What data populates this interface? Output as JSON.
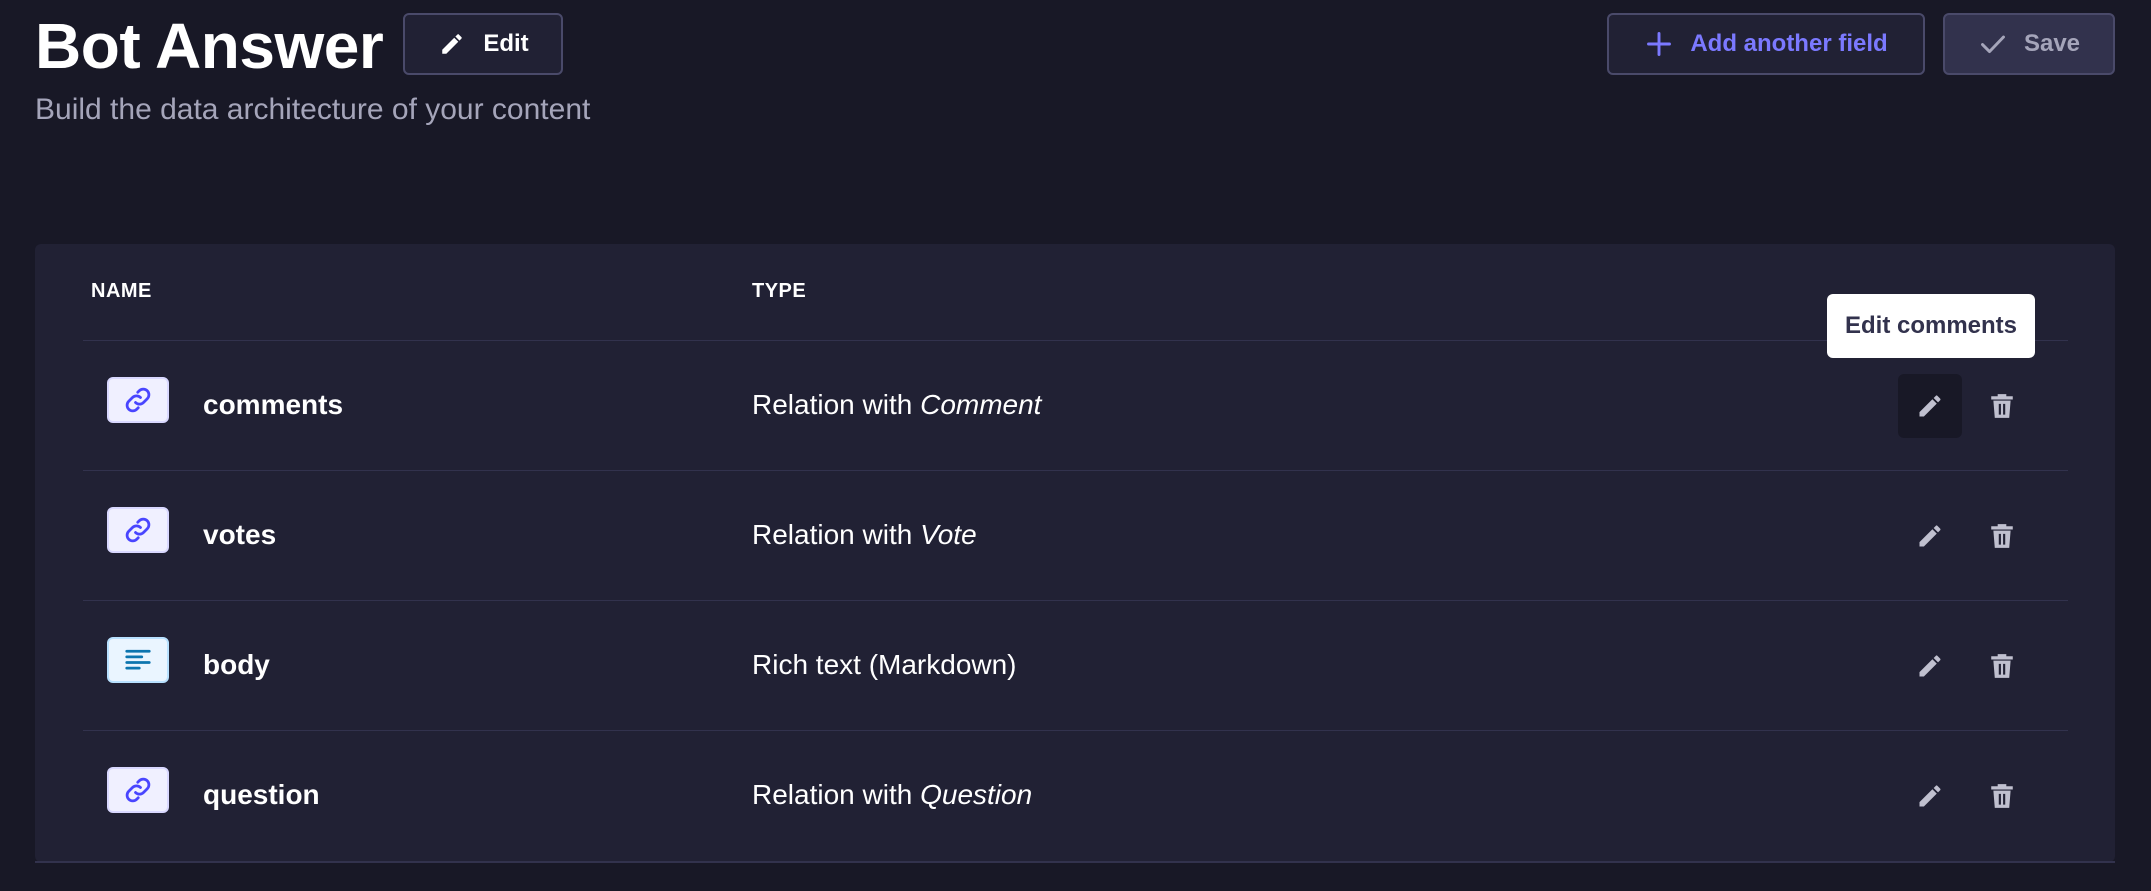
{
  "header": {
    "title": "Bot Answer",
    "subtitle": "Build the data architecture of your content",
    "edit_label": "Edit",
    "add_field_label": "Add another field",
    "save_label": "Save"
  },
  "table": {
    "columns": {
      "name": "NAME",
      "type": "TYPE"
    },
    "rows": [
      {
        "name": "comments",
        "type_prefix": "Relation with ",
        "type_target": "Comment",
        "icon": "relation-icon"
      },
      {
        "name": "votes",
        "type_prefix": "Relation with ",
        "type_target": "Vote",
        "icon": "relation-icon"
      },
      {
        "name": "body",
        "type_prefix": "Rich text (Markdown)",
        "type_target": "",
        "icon": "rich-text-icon"
      },
      {
        "name": "question",
        "type_prefix": "Relation with ",
        "type_target": "Question",
        "icon": "relation-icon"
      }
    ]
  },
  "tooltip": {
    "text": "Edit comments"
  },
  "colors": {
    "background": "#181826",
    "card": "#212134",
    "accent": "#7b79ff",
    "muted_text": "#a5a5ba"
  }
}
